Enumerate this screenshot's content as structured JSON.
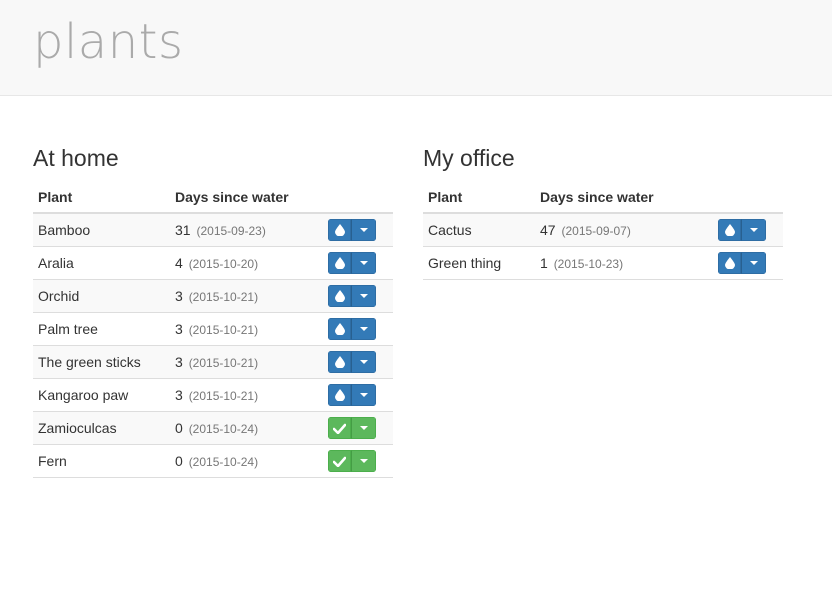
{
  "brand": {
    "title": "plants"
  },
  "sections": [
    {
      "title": "At home",
      "headers": {
        "plant": "Plant",
        "days": "Days since water"
      },
      "rows": [
        {
          "plant": "Bamboo",
          "days": "31",
          "date": "(2015-09-23)",
          "status": "water"
        },
        {
          "plant": "Aralia",
          "days": "4",
          "date": "(2015-10-20)",
          "status": "water"
        },
        {
          "plant": "Orchid",
          "days": "3",
          "date": "(2015-10-21)",
          "status": "water"
        },
        {
          "plant": "Palm tree",
          "days": "3",
          "date": "(2015-10-21)",
          "status": "water"
        },
        {
          "plant": "The green sticks",
          "days": "3",
          "date": "(2015-10-21)",
          "status": "water"
        },
        {
          "plant": "Kangaroo paw",
          "days": "3",
          "date": "(2015-10-21)",
          "status": "water"
        },
        {
          "plant": "Zamioculcas",
          "days": "0",
          "date": "(2015-10-24)",
          "status": "done"
        },
        {
          "plant": "Fern",
          "days": "0",
          "date": "(2015-10-24)",
          "status": "done"
        }
      ]
    },
    {
      "title": "My office",
      "headers": {
        "plant": "Plant",
        "days": "Days since water"
      },
      "rows": [
        {
          "plant": "Cactus",
          "days": "47",
          "date": "(2015-09-07)",
          "status": "water"
        },
        {
          "plant": "Green thing",
          "days": "1",
          "date": "(2015-10-23)",
          "status": "water"
        }
      ]
    }
  ],
  "icons": {
    "water": "water-drop-icon",
    "done": "checkmark-icon",
    "menu": "caret-down-icon"
  },
  "colors": {
    "water_button": "#337ab7",
    "done_button": "#5cb85c",
    "header_bg": "#f8f8f8",
    "brand_text": "#aaaaaa"
  }
}
